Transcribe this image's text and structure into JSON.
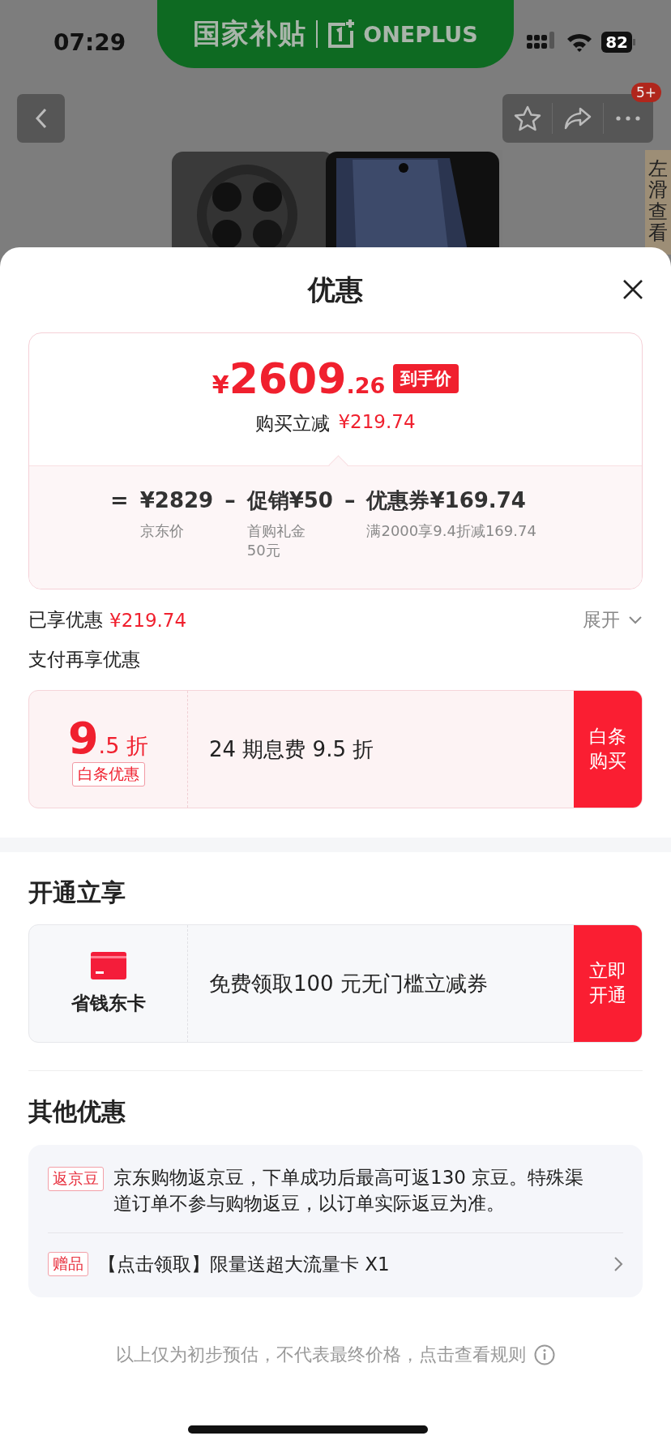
{
  "status_bar": {
    "time": "07:29",
    "battery": "82"
  },
  "banner": {
    "title": "国家补贴",
    "brand": "ONEPLUS"
  },
  "product_header": {
    "badge": "5+",
    "side_hint": "左滑查看"
  },
  "sheet": {
    "title": "优惠"
  },
  "price_card": {
    "currency": "¥",
    "integer": "2609",
    "decimal": ".26",
    "tag": "到手价",
    "saving_label": "购买立减",
    "saving": "¥219.74",
    "formula": [
      {
        "operator": "=",
        "value": "¥2829",
        "note": "京东价"
      },
      {
        "operator": "–",
        "value": "促销¥50",
        "note": "首购礼金50元"
      },
      {
        "operator": "–",
        "value": "优惠券¥169.74",
        "note": "满2000享9.4折减169.74"
      }
    ]
  },
  "applied": {
    "label": "已享优惠",
    "amount": "¥219.74",
    "toggle": "展开",
    "expanded": false
  },
  "pay_offer": {
    "title": "支付再享优惠",
    "discount_main": "9",
    "discount_decimal": ".5",
    "discount_unit": "折",
    "tag": "白条优惠",
    "text": "24 期息费 9.5 折",
    "button": "白条购买"
  },
  "membership": {
    "title": "开通立享",
    "name": "省钱东卡",
    "text": "免费领取100 元无门槛立减券",
    "button": "立即开通"
  },
  "other_offers": {
    "title": "其他优惠",
    "items": [
      {
        "kind": "info",
        "tag": "返京豆",
        "text": "京东购物返京豆，下单成功后最高可返130 京豆。特殊渠道订单不参与购物返豆，以订单实际返豆为准。"
      },
      {
        "kind": "link",
        "tag": "赠品",
        "text": "【点击领取】限量送超大流量卡 X1"
      }
    ]
  },
  "footnote": "以上仅为初步预估，不代表最终价格，点击查看规则"
}
